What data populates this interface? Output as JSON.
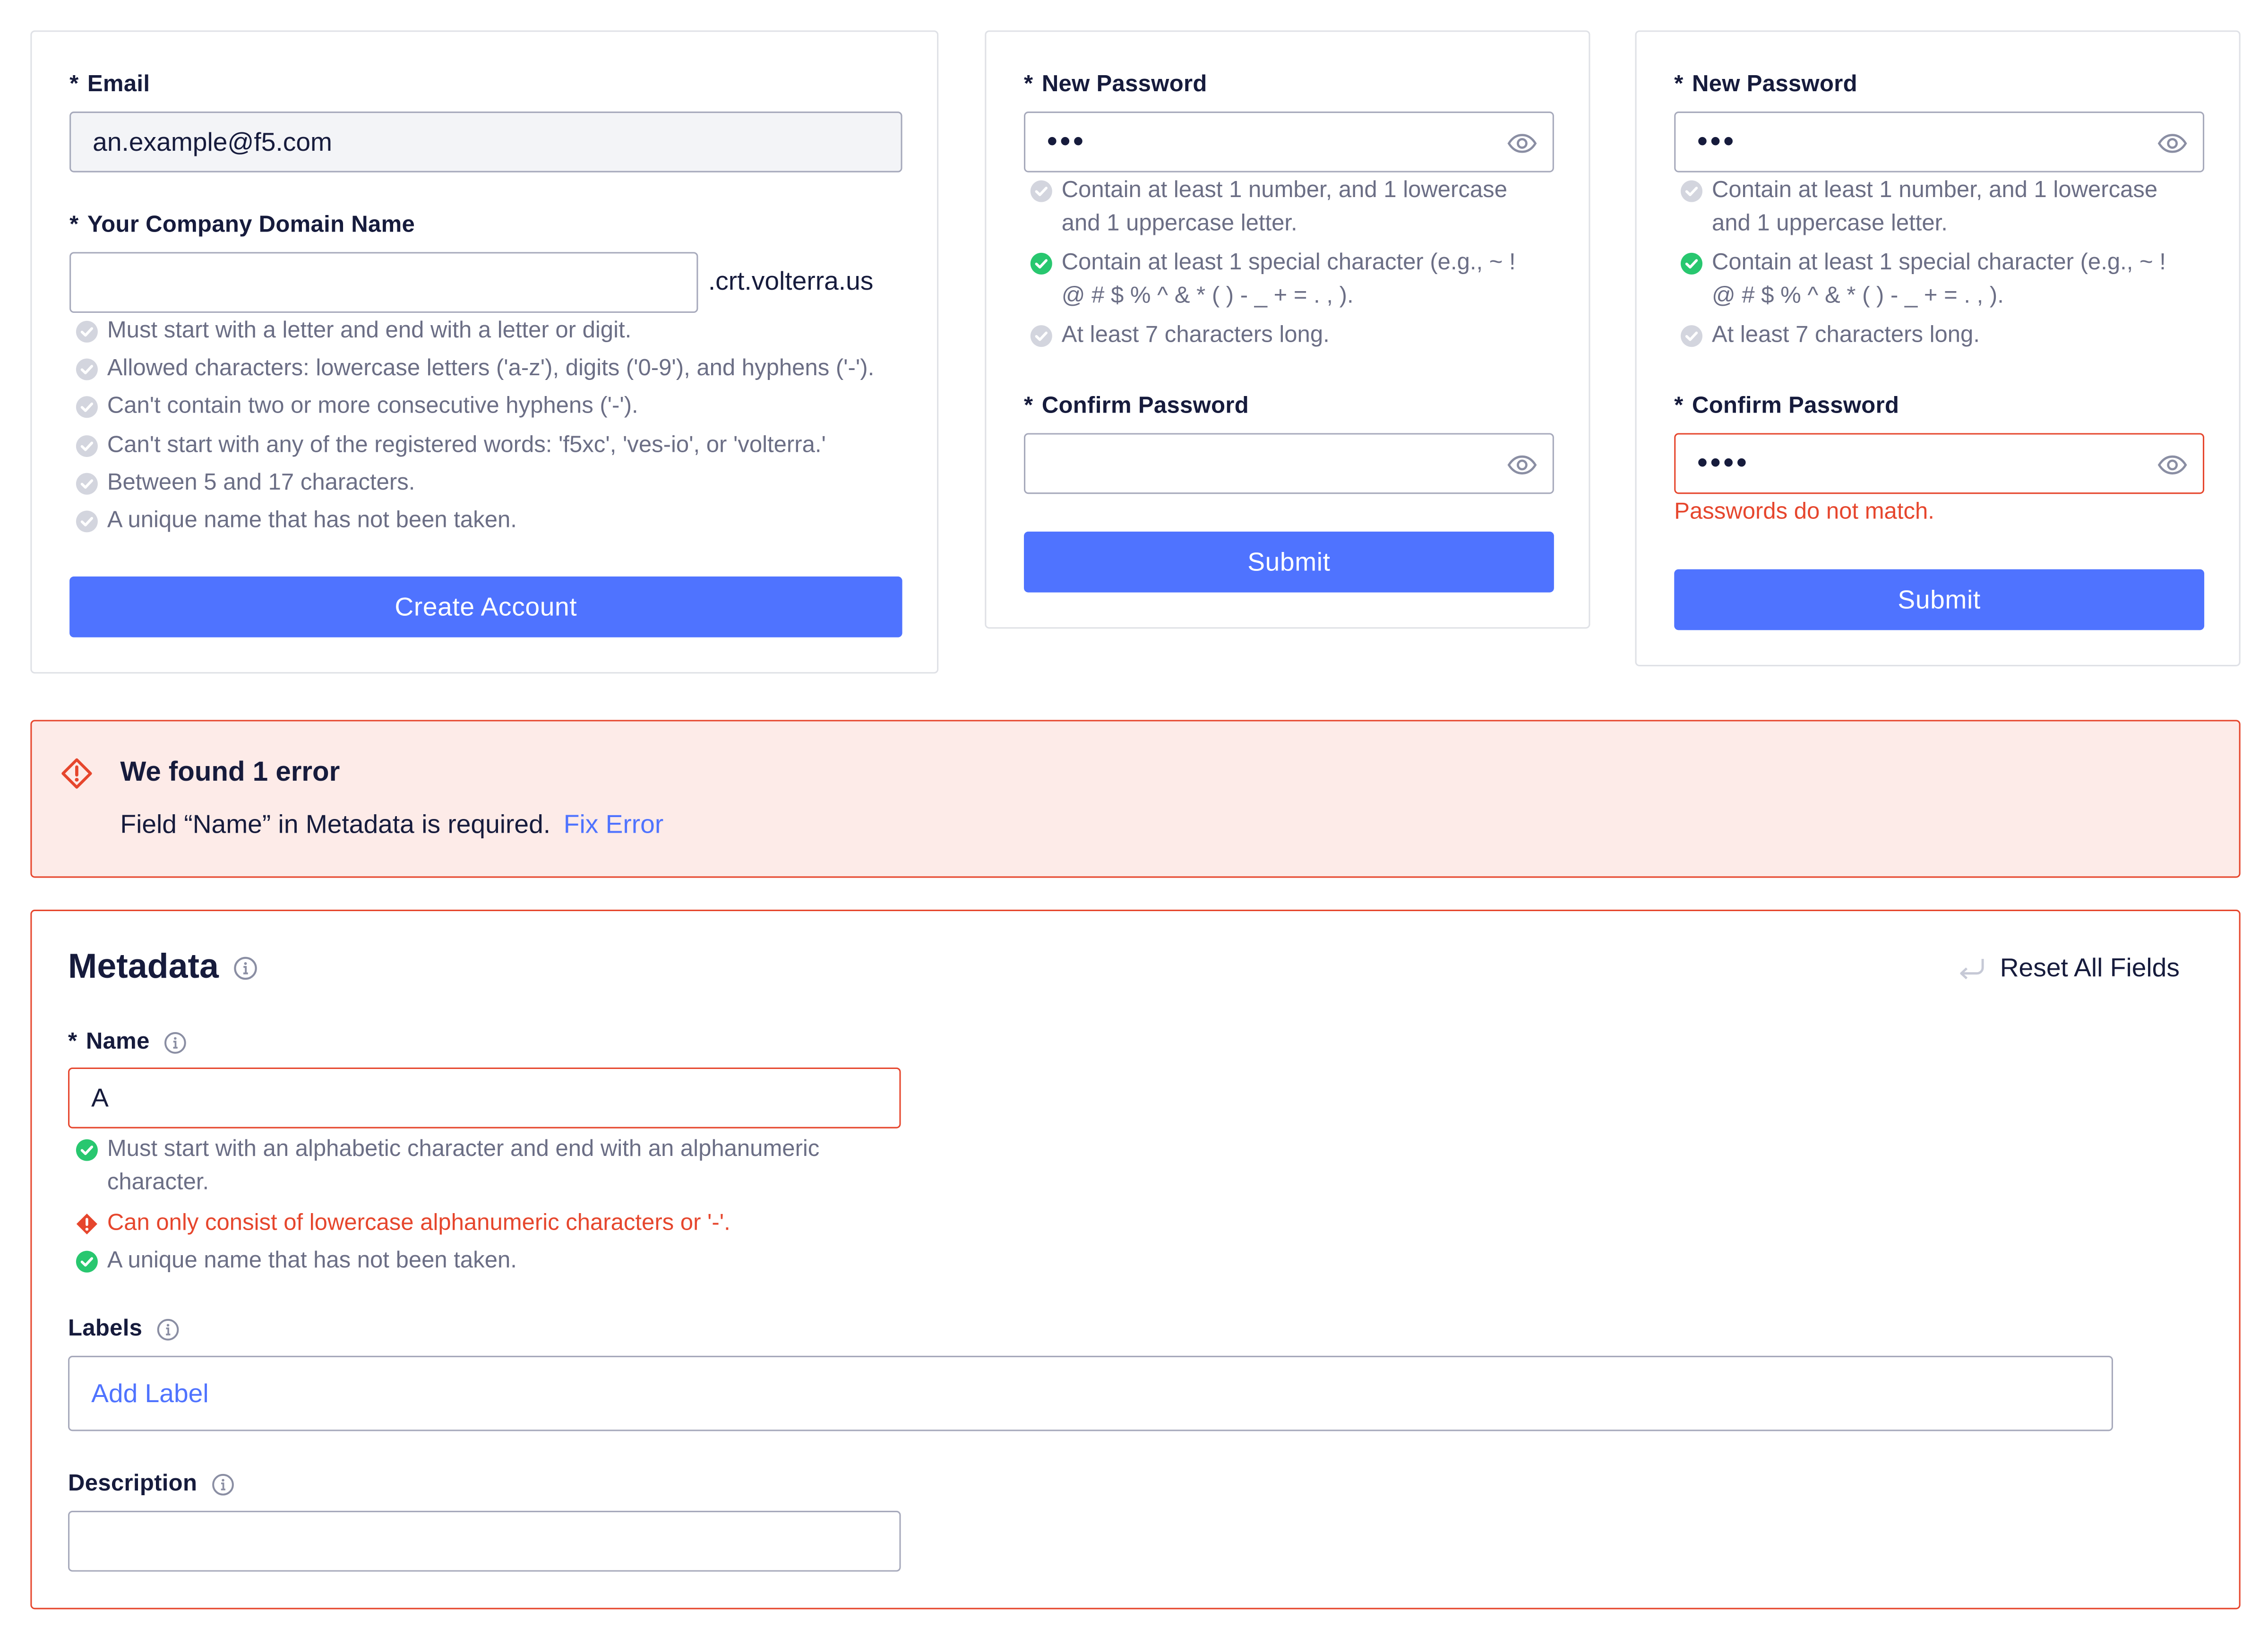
{
  "signup": {
    "email_label": "Email",
    "email_value": "an.example@f5.com",
    "domain_label": "Your Company Domain Name",
    "domain_suffix": ".crt.volterra.us",
    "rules": [
      "Must start with a letter and end with a letter or digit.",
      "Allowed characters: lowercase letters ('a-z'), digits ('0-9'), and hyphens ('-').",
      "Can't contain two or more consecutive hyphens ('-').",
      "Can't start with any of the registered words: 'f5xc', 'ves-io', or 'volterra.'",
      "Between 5 and 17 characters.",
      "A unique name that has not been taken."
    ],
    "button_label": "Create Account"
  },
  "password_a": {
    "new_label": "New Password",
    "new_value": "•••",
    "rules": [
      {
        "line1": "Contain at least 1 number, and 1 lowercase",
        "line2": "and 1 uppercase letter.",
        "status": "pending"
      },
      {
        "line1": "Contain at least 1 special character (e.g., ~ !",
        "line2": "@ # $ % ^ & * ( ) - _ + = . , ).",
        "status": "ok"
      },
      {
        "line1": "At least 7 characters long.",
        "line2": "",
        "status": "pending"
      }
    ],
    "confirm_label": "Confirm Password",
    "confirm_value": "",
    "button_label": "Submit"
  },
  "password_b": {
    "new_label": "New Password",
    "new_value": "•••",
    "rules": [
      {
        "line1": "Contain at least 1 number, and 1 lowercase",
        "line2": "and 1 uppercase letter.",
        "status": "pending"
      },
      {
        "line1": "Contain at least 1 special character (e.g., ~ !",
        "line2": "@ # $ % ^ & * ( ) - _ + = . , ).",
        "status": "ok"
      },
      {
        "line1": "At least 7 characters long.",
        "line2": "",
        "status": "pending"
      }
    ],
    "confirm_label": "Confirm Password",
    "confirm_value": "••••",
    "error": "Passwords do not match.",
    "button_label": "Submit"
  },
  "alert": {
    "title": "We found 1 error",
    "message": "Field “Name” in Metadata is required.",
    "link": "Fix Error"
  },
  "metadata": {
    "title": "Metadata",
    "reset_label": "Reset All Fields",
    "name_label": "Name",
    "name_value": "A",
    "name_rules": [
      {
        "line1": "Must start with an alphabetic character and end with an alphanumeric",
        "line2": "character.",
        "status": "ok"
      },
      {
        "line1": "Can only consist of lowercase alphanumeric characters or '-'.",
        "line2": "",
        "status": "error"
      },
      {
        "line1": "A unique name that has not been taken.",
        "line2": "",
        "status": "ok"
      }
    ],
    "labels_label": "Labels",
    "labels_placeholder": "Add Label",
    "description_label": "Description",
    "description_value": ""
  },
  "colors": {
    "primary": "#4f73ff",
    "error": "#e6462d",
    "success": "#28c76f",
    "pending": "#d3d5de",
    "alert_bg": "#fdebe8"
  }
}
